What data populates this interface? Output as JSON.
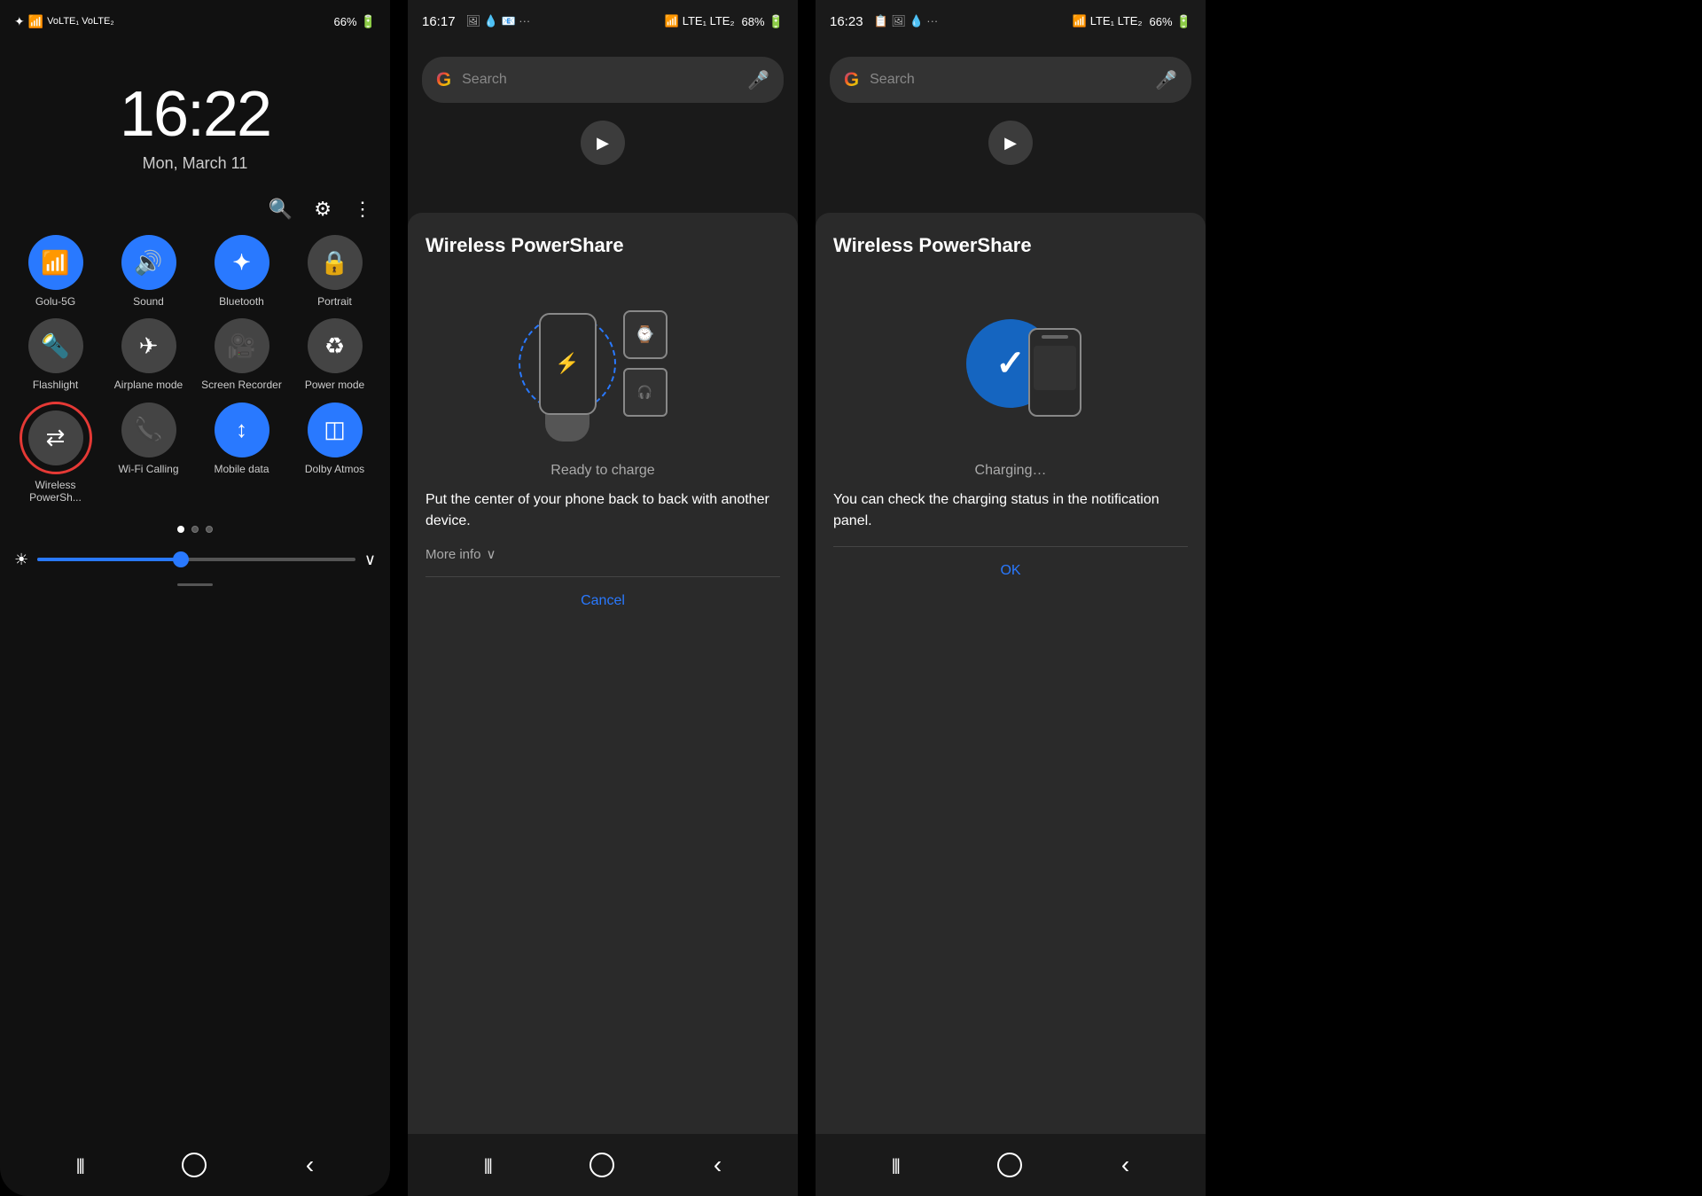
{
  "panel1": {
    "status_bar": {
      "left_icons": [
        "bluetooth",
        "wifi",
        "network"
      ],
      "battery": "66%"
    },
    "time": "16:22",
    "date": "Mon, March 11",
    "toolbar": {
      "search_icon": "search-icon",
      "settings_icon": "gear-icon",
      "more_icon": "more-icon"
    },
    "tiles": [
      {
        "id": "wifi",
        "label": "Golu-5G",
        "active": true,
        "icon": "wifi"
      },
      {
        "id": "sound",
        "label": "Sound",
        "active": true,
        "icon": "sound"
      },
      {
        "id": "bluetooth",
        "label": "Bluetooth",
        "active": true,
        "icon": "bluetooth"
      },
      {
        "id": "portrait",
        "label": "Portrait",
        "active": false,
        "icon": "portrait"
      },
      {
        "id": "flashlight",
        "label": "Flashlight",
        "active": false,
        "icon": "flashlight"
      },
      {
        "id": "airplane",
        "label": "Airplane mode",
        "active": false,
        "icon": "airplane"
      },
      {
        "id": "screenrec",
        "label": "Screen Recorder",
        "active": false,
        "icon": "screenrec"
      },
      {
        "id": "power",
        "label": "Power mode",
        "active": false,
        "icon": "power"
      },
      {
        "id": "wps",
        "label": "Wireless PowerSh...",
        "active": false,
        "icon": "wps",
        "highlighted": true
      },
      {
        "id": "wificall",
        "label": "Wi-Fi Calling",
        "active": false,
        "icon": "wifi-call"
      },
      {
        "id": "mobile",
        "label": "Mobile data",
        "active": true,
        "icon": "mobile"
      },
      {
        "id": "dolby",
        "label": "Dolby Atmos",
        "active": true,
        "icon": "dolby"
      }
    ],
    "page_dots": [
      {
        "active": true
      },
      {
        "active": false
      },
      {
        "active": false
      }
    ],
    "brightness_label": "brightness",
    "nav": {
      "recents": "|||",
      "home": "○",
      "back": "<"
    }
  },
  "panel2": {
    "status_bar": {
      "time": "16:17",
      "battery": "68%"
    },
    "google_bar": {
      "placeholder": "Search"
    },
    "dialog": {
      "title": "Wireless PowerShare",
      "status": "Ready to charge",
      "description": "Put the center of your phone back to back with another device.",
      "more_info": "More info",
      "cancel_btn": "Cancel"
    }
  },
  "panel3": {
    "status_bar": {
      "time": "16:23",
      "battery": "66%"
    },
    "google_bar": {
      "placeholder": "Search"
    },
    "dialog": {
      "title": "Wireless PowerShare",
      "status": "Charging…",
      "description": "You can check the charging status in the notification panel.",
      "ok_btn": "OK"
    }
  }
}
